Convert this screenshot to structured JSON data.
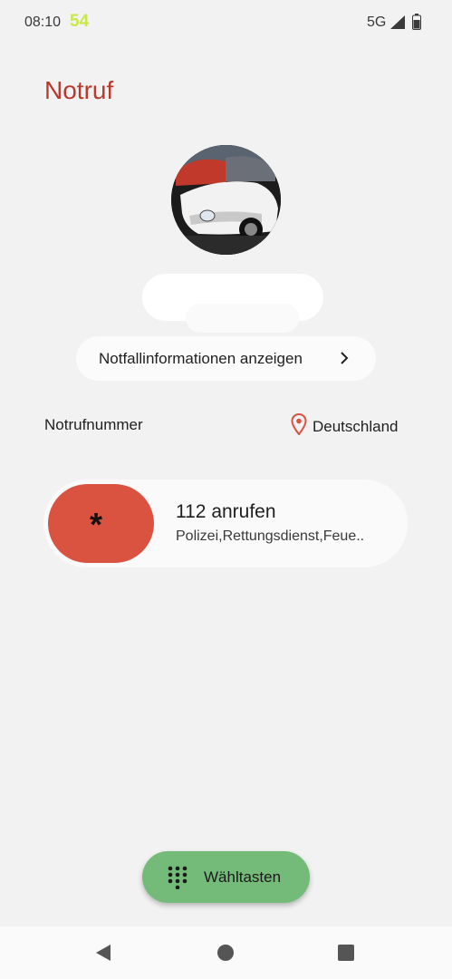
{
  "status_bar": {
    "time": "08:10",
    "counter": "54",
    "network": "5G"
  },
  "header": {
    "title": "Notruf"
  },
  "info_button": {
    "label": "Notfallinformationen anzeigen"
  },
  "emergency_section": {
    "label": "Notrufnummer",
    "location": "Deutschland"
  },
  "call_card": {
    "symbol": "*",
    "title": "112 anrufen",
    "subtitle": "Polizei,Rettungsdienst,Feue.."
  },
  "keypad": {
    "label": "Wähltasten"
  },
  "colors": {
    "title": "#b83a2e",
    "call_pill": "#d95340",
    "keypad_fab": "#74bb7a",
    "location_pin": "#d95340"
  },
  "icons": {
    "chevron": "chevron-right-icon",
    "location": "location-pin-icon",
    "keypad": "dialpad-icon",
    "signal": "signal-icon",
    "battery": "battery-icon"
  }
}
